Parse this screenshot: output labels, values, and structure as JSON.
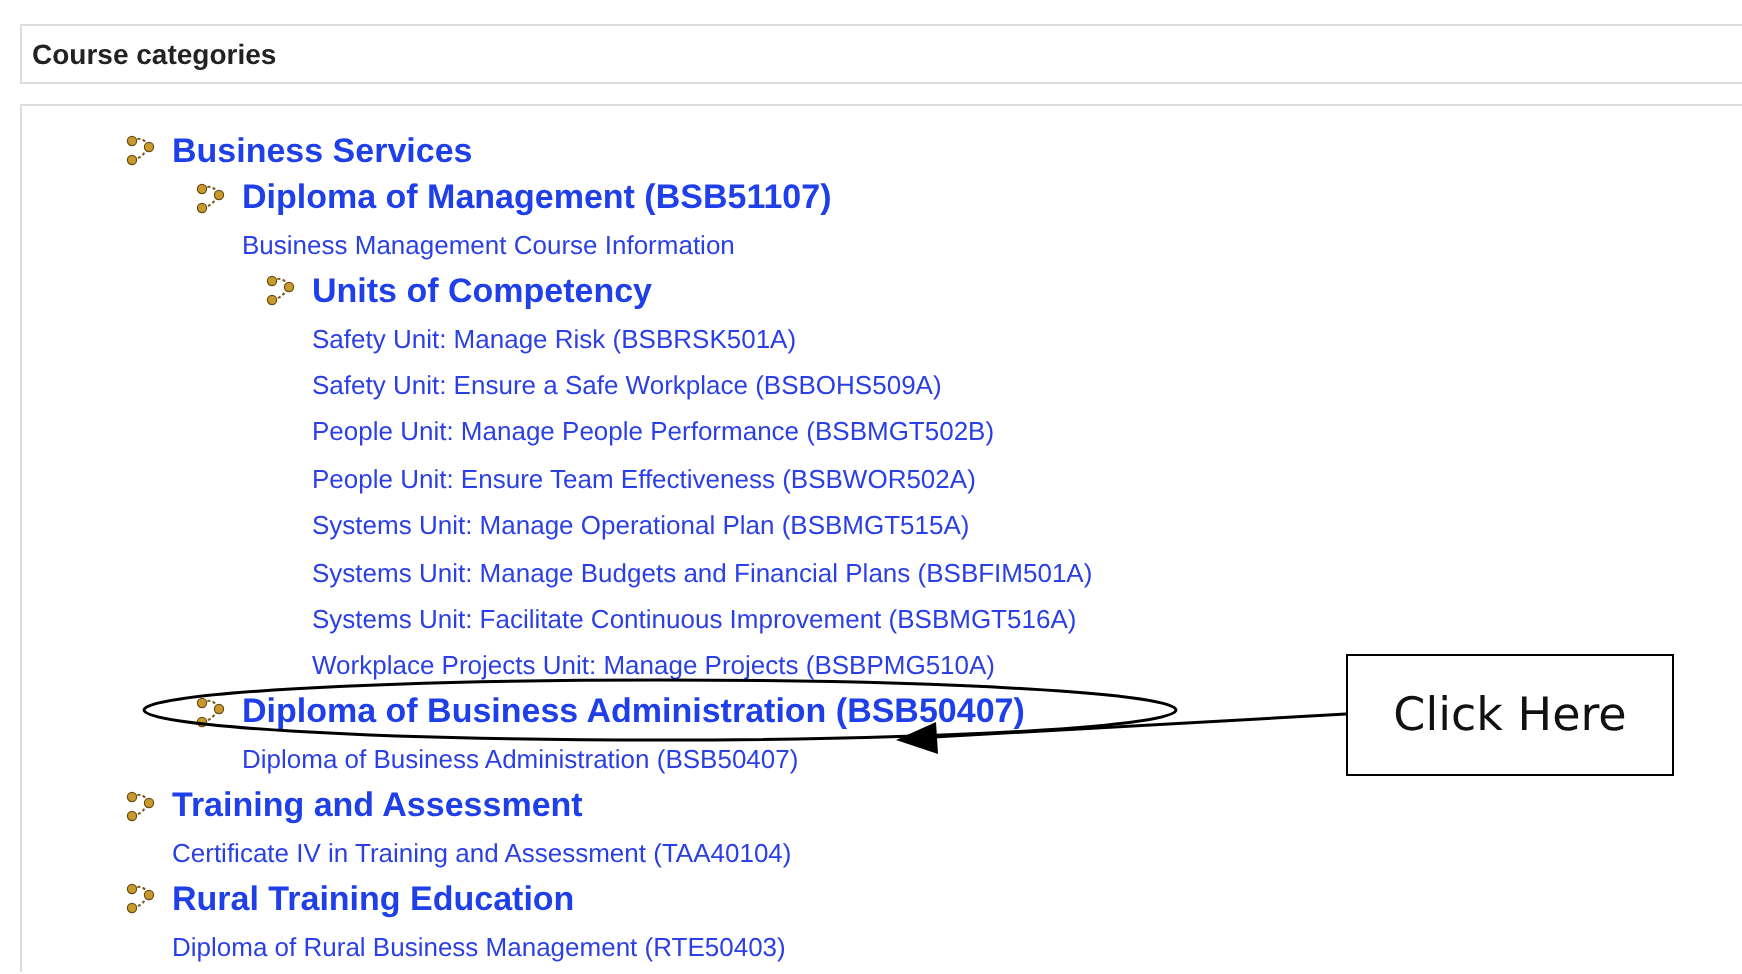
{
  "header": {
    "title": "Course categories"
  },
  "categories": [
    {
      "name": "Business Services",
      "children": [
        {
          "name": "Diploma of Management (BSB51107)",
          "courses": [
            "Business Management Course Information"
          ],
          "children": [
            {
              "name": "Units of Competency",
              "courses": [
                "Safety Unit: Manage Risk (BSBRSK501A)",
                "Safety Unit: Ensure a Safe Workplace (BSBOHS509A)",
                "People Unit: Manage People Performance (BSBMGT502B)",
                "People Unit: Ensure Team Effectiveness (BSBWOR502A)",
                "Systems Unit: Manage Operational Plan (BSBMGT515A)",
                "Systems Unit: Manage Budgets and Financial Plans (BSBFIM501A)",
                "Systems Unit: Facilitate Continuous Improvement (BSBMGT516A)",
                "Workplace Projects Unit: Manage Projects (BSBPMG510A)"
              ]
            }
          ]
        },
        {
          "name": "Diploma of Business Administration (BSB50407)",
          "courses": [
            "Diploma of Business Administration (BSB50407)"
          ]
        }
      ]
    },
    {
      "name": "Training and Assessment",
      "courses": [
        "Certificate IV in Training and Assessment (TAA40104)"
      ]
    },
    {
      "name": "Rural Training Education",
      "courses": [
        "Diploma of Rural Business Management (RTE50403)"
      ]
    }
  ],
  "callout": {
    "text": "Click Here"
  }
}
